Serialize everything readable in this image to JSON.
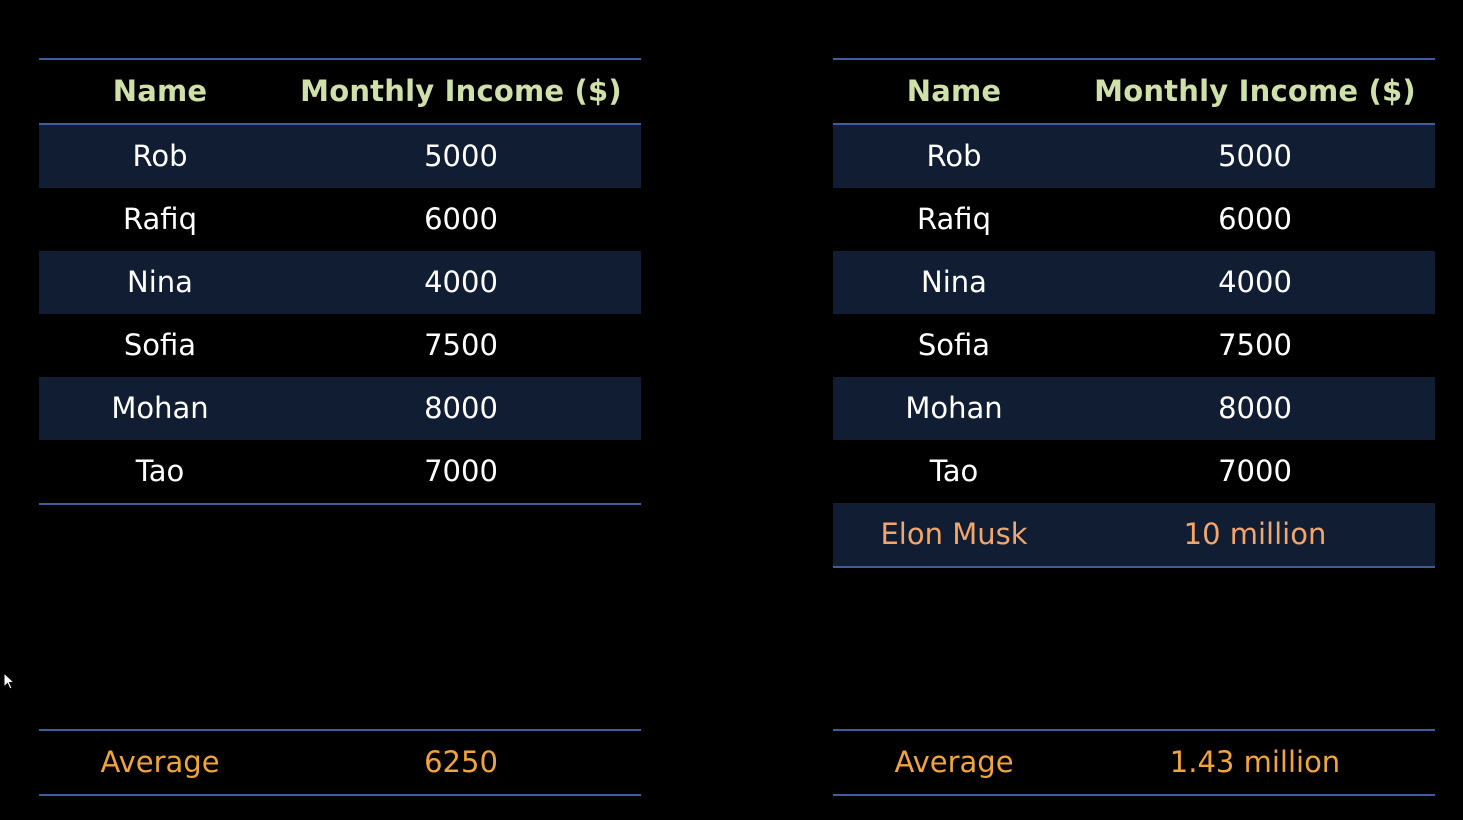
{
  "left_table": {
    "header": {
      "name": "Name",
      "income": "Monthly Income ($)"
    },
    "rows": [
      {
        "name": "Rob",
        "income": "5000"
      },
      {
        "name": "Rafiq",
        "income": "6000"
      },
      {
        "name": "Nina",
        "income": "4000"
      },
      {
        "name": "Sofia",
        "income": "7500"
      },
      {
        "name": "Mohan",
        "income": "8000"
      },
      {
        "name": "Tao",
        "income": "7000"
      }
    ],
    "average": {
      "label": "Average",
      "value": "6250"
    }
  },
  "right_table": {
    "header": {
      "name": "Name",
      "income": "Monthly Income ($)"
    },
    "rows": [
      {
        "name": "Rob",
        "income": "5000"
      },
      {
        "name": "Rafiq",
        "income": "6000"
      },
      {
        "name": "Nina",
        "income": "4000"
      },
      {
        "name": "Sofia",
        "income": "7500"
      },
      {
        "name": "Mohan",
        "income": "8000"
      },
      {
        "name": "Tao",
        "income": "7000"
      }
    ],
    "outlier": {
      "name": "Elon Musk",
      "income": "10 million"
    },
    "average": {
      "label": "Average",
      "value": "1.43 million"
    }
  },
  "colors": {
    "background": "#000000",
    "rule": "#3f5e9c",
    "band": "#111d33",
    "header_text": "#cfe0a9",
    "outlier_text": "#f2a66b",
    "average_text": "#f0a43a"
  },
  "icons": {
    "cursor": "mouse-pointer-icon"
  }
}
